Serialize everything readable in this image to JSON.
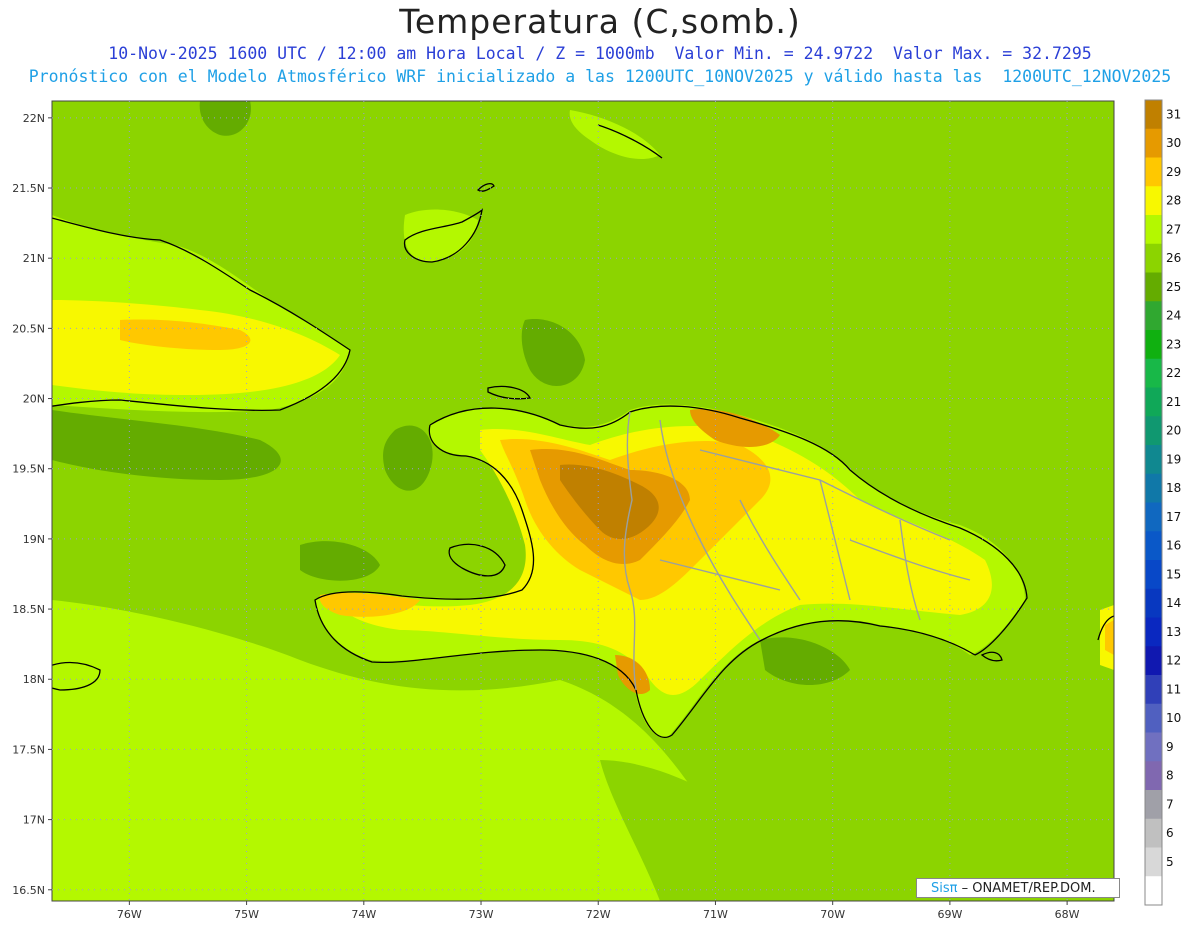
{
  "title": "Temperatura (C,somb.)",
  "subtitle1": "10-Nov-2025 1600 UTC / 12:00 am Hora Local / Z = 1000mb  Valor Min. = 24.9722  Valor Max. = 32.7295",
  "subtitle2": "Pronóstico con el Modelo Atmosférico WRF inicializado a las 1200UTC_10NOV2025 y válido hasta las  1200UTC_12NOV2025",
  "credit": {
    "brand": "Sisπ",
    "text": " – ONAMET/REP.DOM."
  },
  "map": {
    "lon_range": [
      -76.66,
      -67.6
    ],
    "lat_range": [
      16.42,
      22.12
    ],
    "lat_ticks": [
      "22N",
      "21.5N",
      "21N",
      "20.5N",
      "20N",
      "19.5N",
      "19N",
      "18.5N",
      "18N",
      "17.5N",
      "17N",
      "16.5N"
    ],
    "lat_tick_values": [
      22,
      21.5,
      21,
      20.5,
      20,
      19.5,
      19,
      18.5,
      18,
      17.5,
      17,
      16.5
    ],
    "lon_ticks": [
      "76W",
      "75W",
      "74W",
      "73W",
      "72W",
      "71W",
      "70W",
      "69W",
      "68W"
    ],
    "lon_tick_values": [
      -76,
      -75,
      -74,
      -73,
      -72,
      -71,
      -70,
      -69,
      -68
    ],
    "grid": "dotted",
    "background_color": "#8cd400"
  },
  "colorbar": {
    "labels": [
      "31",
      "30",
      "29",
      "28",
      "27",
      "26",
      "25",
      "24",
      "23",
      "22",
      "21",
      "20",
      "19",
      "18",
      "17",
      "16",
      "15",
      "14",
      "13",
      "12",
      "11",
      "10",
      "9",
      "8",
      "7",
      "6",
      "5"
    ],
    "colors": [
      "#c08000",
      "#e69a00",
      "#ffc800",
      "#f8f800",
      "#b4f800",
      "#8cd400",
      "#64ac00",
      "#30a830",
      "#10b010",
      "#18b848",
      "#10a858",
      "#109870",
      "#108890",
      "#1078a8",
      "#1068c0",
      "#0a58c8",
      "#0848c8",
      "#0838c0",
      "#0a28c0",
      "#1018b0",
      "#3040b8",
      "#5060c0",
      "#7070c0",
      "#8068b0",
      "#a0a0a8",
      "#c0c0c0",
      "#d8d8d8",
      "#ffffff"
    ]
  }
}
